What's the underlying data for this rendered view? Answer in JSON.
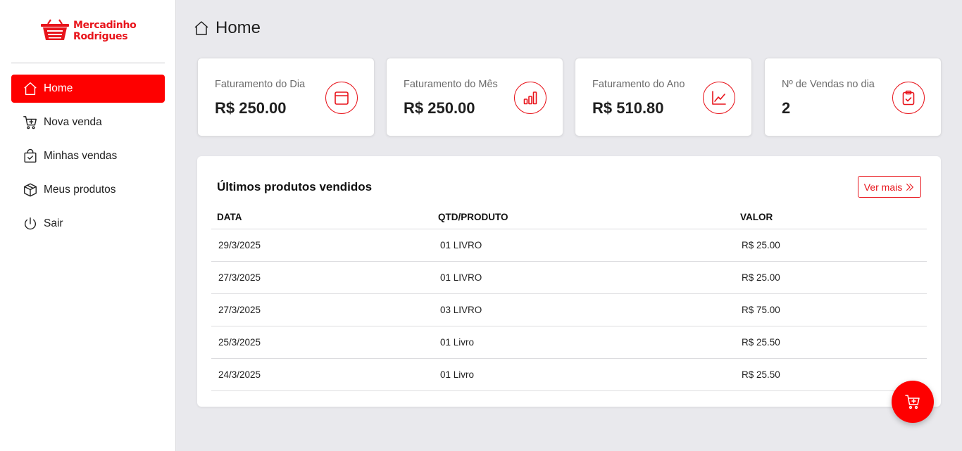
{
  "brand": {
    "line1": "Mercadinho",
    "line2": "Rodrigues",
    "color": "#e8141b"
  },
  "sidebar": {
    "items": [
      {
        "label": "Home",
        "icon": "home-icon",
        "active": true
      },
      {
        "label": "Nova venda",
        "icon": "cart-plus-icon",
        "active": false
      },
      {
        "label": "Minhas vendas",
        "icon": "bag-check-icon",
        "active": false
      },
      {
        "label": "Meus produtos",
        "icon": "box-icon",
        "active": false
      },
      {
        "label": "Sair",
        "icon": "power-icon",
        "active": false
      }
    ]
  },
  "header": {
    "title": "Home",
    "icon": "home-icon"
  },
  "cards": [
    {
      "label": "Faturamento do Dia",
      "value": "R$ 250.00",
      "icon": "calendar-icon"
    },
    {
      "label": "Faturamento do Mês",
      "value": "R$ 250.00",
      "icon": "bar-chart-icon"
    },
    {
      "label": "Faturamento do Ano",
      "value": "R$ 510.80",
      "icon": "line-chart-icon"
    },
    {
      "label": "Nº de Vendas no dia",
      "value": "2",
      "icon": "clipboard-check-icon"
    }
  ],
  "recent": {
    "title": "Últimos produtos vendidos",
    "more_label": "Ver mais",
    "columns": [
      "DATA",
      "QTD/PRODUTO",
      "VALOR"
    ],
    "rows": [
      [
        "29/3/2025",
        "01 LIVRO",
        "R$ 25.00"
      ],
      [
        "27/3/2025",
        "01 LIVRO",
        "R$ 25.00"
      ],
      [
        "27/3/2025",
        "03 LIVRO",
        "R$ 75.00"
      ],
      [
        "25/3/2025",
        "01 Livro",
        "R$ 25.50"
      ],
      [
        "24/3/2025",
        "01 Livro",
        "R$ 25.50"
      ]
    ]
  },
  "fab": {
    "icon": "cart-plus-icon"
  },
  "colors": {
    "accent": "#fe0000",
    "background": "#e9e9ed"
  }
}
